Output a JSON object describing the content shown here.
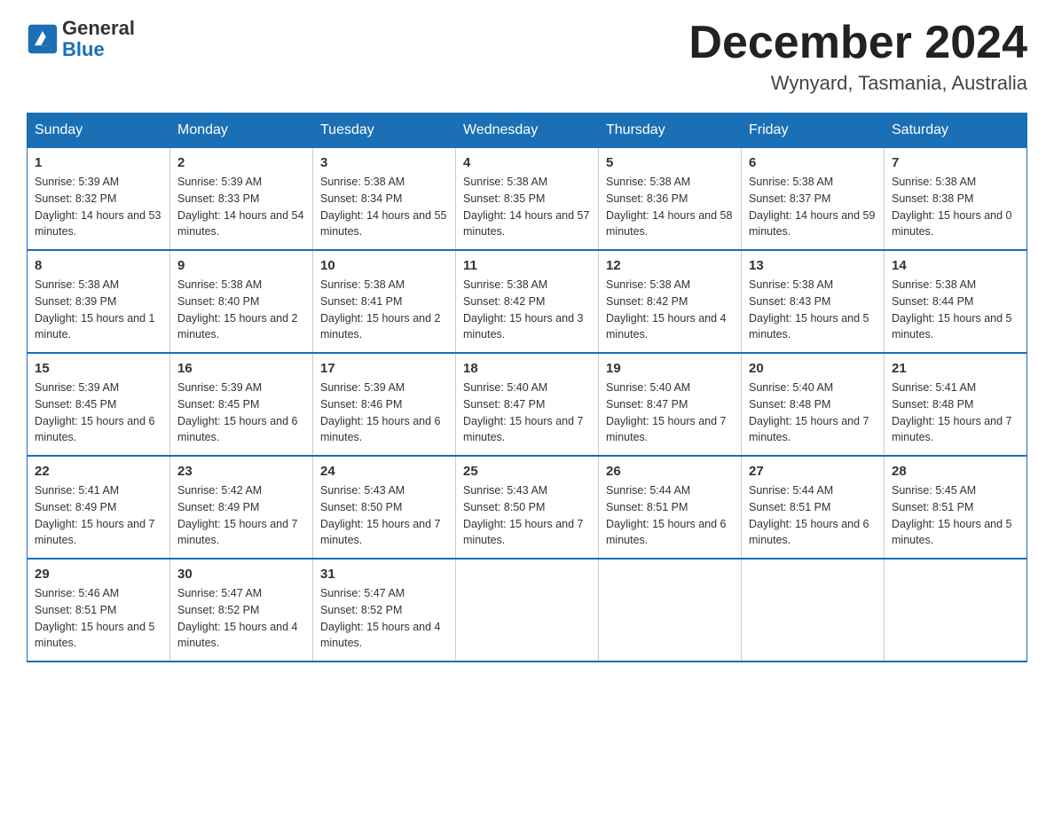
{
  "header": {
    "logo_general": "General",
    "logo_blue": "Blue",
    "month_title": "December 2024",
    "location": "Wynyard, Tasmania, Australia"
  },
  "weekdays": [
    "Sunday",
    "Monday",
    "Tuesday",
    "Wednesday",
    "Thursday",
    "Friday",
    "Saturday"
  ],
  "weeks": [
    [
      {
        "day": "1",
        "sunrise": "5:39 AM",
        "sunset": "8:32 PM",
        "daylight": "14 hours and 53 minutes."
      },
      {
        "day": "2",
        "sunrise": "5:39 AM",
        "sunset": "8:33 PM",
        "daylight": "14 hours and 54 minutes."
      },
      {
        "day": "3",
        "sunrise": "5:38 AM",
        "sunset": "8:34 PM",
        "daylight": "14 hours and 55 minutes."
      },
      {
        "day": "4",
        "sunrise": "5:38 AM",
        "sunset": "8:35 PM",
        "daylight": "14 hours and 57 minutes."
      },
      {
        "day": "5",
        "sunrise": "5:38 AM",
        "sunset": "8:36 PM",
        "daylight": "14 hours and 58 minutes."
      },
      {
        "day": "6",
        "sunrise": "5:38 AM",
        "sunset": "8:37 PM",
        "daylight": "14 hours and 59 minutes."
      },
      {
        "day": "7",
        "sunrise": "5:38 AM",
        "sunset": "8:38 PM",
        "daylight": "15 hours and 0 minutes."
      }
    ],
    [
      {
        "day": "8",
        "sunrise": "5:38 AM",
        "sunset": "8:39 PM",
        "daylight": "15 hours and 1 minute."
      },
      {
        "day": "9",
        "sunrise": "5:38 AM",
        "sunset": "8:40 PM",
        "daylight": "15 hours and 2 minutes."
      },
      {
        "day": "10",
        "sunrise": "5:38 AM",
        "sunset": "8:41 PM",
        "daylight": "15 hours and 2 minutes."
      },
      {
        "day": "11",
        "sunrise": "5:38 AM",
        "sunset": "8:42 PM",
        "daylight": "15 hours and 3 minutes."
      },
      {
        "day": "12",
        "sunrise": "5:38 AM",
        "sunset": "8:42 PM",
        "daylight": "15 hours and 4 minutes."
      },
      {
        "day": "13",
        "sunrise": "5:38 AM",
        "sunset": "8:43 PM",
        "daylight": "15 hours and 5 minutes."
      },
      {
        "day": "14",
        "sunrise": "5:38 AM",
        "sunset": "8:44 PM",
        "daylight": "15 hours and 5 minutes."
      }
    ],
    [
      {
        "day": "15",
        "sunrise": "5:39 AM",
        "sunset": "8:45 PM",
        "daylight": "15 hours and 6 minutes."
      },
      {
        "day": "16",
        "sunrise": "5:39 AM",
        "sunset": "8:45 PM",
        "daylight": "15 hours and 6 minutes."
      },
      {
        "day": "17",
        "sunrise": "5:39 AM",
        "sunset": "8:46 PM",
        "daylight": "15 hours and 6 minutes."
      },
      {
        "day": "18",
        "sunrise": "5:40 AM",
        "sunset": "8:47 PM",
        "daylight": "15 hours and 7 minutes."
      },
      {
        "day": "19",
        "sunrise": "5:40 AM",
        "sunset": "8:47 PM",
        "daylight": "15 hours and 7 minutes."
      },
      {
        "day": "20",
        "sunrise": "5:40 AM",
        "sunset": "8:48 PM",
        "daylight": "15 hours and 7 minutes."
      },
      {
        "day": "21",
        "sunrise": "5:41 AM",
        "sunset": "8:48 PM",
        "daylight": "15 hours and 7 minutes."
      }
    ],
    [
      {
        "day": "22",
        "sunrise": "5:41 AM",
        "sunset": "8:49 PM",
        "daylight": "15 hours and 7 minutes."
      },
      {
        "day": "23",
        "sunrise": "5:42 AM",
        "sunset": "8:49 PM",
        "daylight": "15 hours and 7 minutes."
      },
      {
        "day": "24",
        "sunrise": "5:43 AM",
        "sunset": "8:50 PM",
        "daylight": "15 hours and 7 minutes."
      },
      {
        "day": "25",
        "sunrise": "5:43 AM",
        "sunset": "8:50 PM",
        "daylight": "15 hours and 7 minutes."
      },
      {
        "day": "26",
        "sunrise": "5:44 AM",
        "sunset": "8:51 PM",
        "daylight": "15 hours and 6 minutes."
      },
      {
        "day": "27",
        "sunrise": "5:44 AM",
        "sunset": "8:51 PM",
        "daylight": "15 hours and 6 minutes."
      },
      {
        "day": "28",
        "sunrise": "5:45 AM",
        "sunset": "8:51 PM",
        "daylight": "15 hours and 5 minutes."
      }
    ],
    [
      {
        "day": "29",
        "sunrise": "5:46 AM",
        "sunset": "8:51 PM",
        "daylight": "15 hours and 5 minutes."
      },
      {
        "day": "30",
        "sunrise": "5:47 AM",
        "sunset": "8:52 PM",
        "daylight": "15 hours and 4 minutes."
      },
      {
        "day": "31",
        "sunrise": "5:47 AM",
        "sunset": "8:52 PM",
        "daylight": "15 hours and 4 minutes."
      },
      null,
      null,
      null,
      null
    ]
  ]
}
